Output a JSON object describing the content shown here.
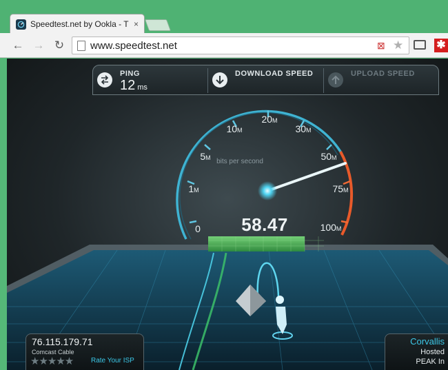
{
  "browser": {
    "tab_title": "Speedtest.net by Ookla - T",
    "tab_close": "×",
    "url": "www.speedtest.net",
    "accent_color": "#4fb273"
  },
  "stats": {
    "ping_label": "PING",
    "ping_value": "12",
    "ping_unit": "ms",
    "download_label": "DOWNLOAD SPEED",
    "upload_label": "UPLOAD SPEED"
  },
  "gauge": {
    "scale_labels": [
      {
        "value": "0",
        "unit": ""
      },
      {
        "value": "1",
        "unit": "M"
      },
      {
        "value": "5",
        "unit": "M"
      },
      {
        "value": "10",
        "unit": "M"
      },
      {
        "value": "20",
        "unit": "M"
      },
      {
        "value": "30",
        "unit": "M"
      },
      {
        "value": "50",
        "unit": "M"
      },
      {
        "value": "75",
        "unit": "M"
      },
      {
        "value": "100",
        "unit": "M"
      }
    ],
    "units_caption": "bits per second",
    "current_speed": "58.47",
    "needle_fraction": 0.78
  },
  "client": {
    "ip": "76.115.179.71",
    "isp": "Comcast Cable",
    "rating_stars": "★★★★★",
    "rate_link": "Rate Your ISP"
  },
  "server": {
    "city": "Corvallis",
    "hosted_label": "Hosted",
    "host": "PEAK In"
  },
  "icons": {
    "ping": "ping-arrows-icon",
    "download": "download-arrow-icon",
    "upload": "upload-arrow-icon",
    "favicon": "speedtest-favicon-icon"
  }
}
